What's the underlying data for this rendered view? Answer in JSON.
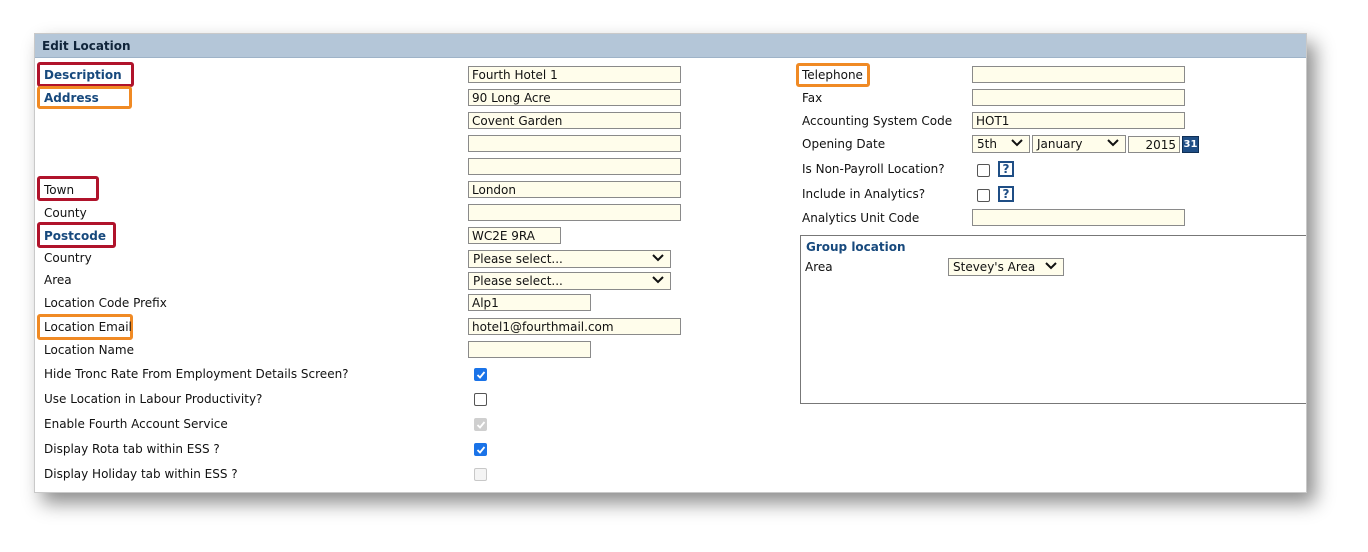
{
  "panel": {
    "title": "Edit Location"
  },
  "left": {
    "description": {
      "label": "Description",
      "value": "Fourth Hotel 1"
    },
    "address": {
      "label": "Address",
      "lines": [
        "90 Long Acre",
        "Covent Garden",
        "",
        ""
      ]
    },
    "town": {
      "label": "Town",
      "value": "London"
    },
    "county": {
      "label": "County",
      "value": ""
    },
    "postcode": {
      "label": "Postcode",
      "value": "WC2E 9RA"
    },
    "country": {
      "label": "Country",
      "value": "Please select..."
    },
    "area": {
      "label": "Area",
      "value": "Please select..."
    },
    "prefix": {
      "label": "Location Code Prefix",
      "value": "Alp1"
    },
    "email": {
      "label": "Location Email",
      "value": "hotel1@fourthmail.com"
    },
    "name": {
      "label": "Location Name",
      "value": ""
    },
    "hide_tronc": {
      "label": "Hide Tronc Rate From Employment Details Screen?",
      "checked": true
    },
    "labour": {
      "label": "Use Location in Labour Productivity?",
      "checked": false
    },
    "account_service": {
      "label": "Enable Fourth Account Service",
      "checked": true,
      "disabled": true
    },
    "rota_tab": {
      "label": "Display Rota tab within ESS ?",
      "checked": true
    },
    "holiday_tab": {
      "label": "Display Holiday tab within ESS ?",
      "checked": false,
      "disabled": true
    }
  },
  "right": {
    "telephone": {
      "label": "Telephone",
      "value": ""
    },
    "fax": {
      "label": "Fax",
      "value": ""
    },
    "accounting": {
      "label": "Accounting System Code",
      "value": "HOT1"
    },
    "opening": {
      "label": "Opening Date",
      "day": "5th",
      "month": "January",
      "year": "2015",
      "calendar_glyph": "31"
    },
    "non_payroll": {
      "label": "Is Non-Payroll Location?",
      "checked": false,
      "help_glyph": "?"
    },
    "analytics": {
      "label": "Include in Analytics?",
      "checked": false,
      "help_glyph": "?"
    },
    "analytics_unit": {
      "label": "Analytics Unit Code",
      "value": ""
    },
    "group": {
      "title": "Group location",
      "area_label": "Area",
      "area_value": "Stevey's Area"
    }
  },
  "colors": {
    "titlebar": "#b4c6d8",
    "highlight_red": "#b0132b",
    "highlight_orange": "#f08a24",
    "label_blue": "#17497d",
    "input_bg": "#fffdeb"
  }
}
